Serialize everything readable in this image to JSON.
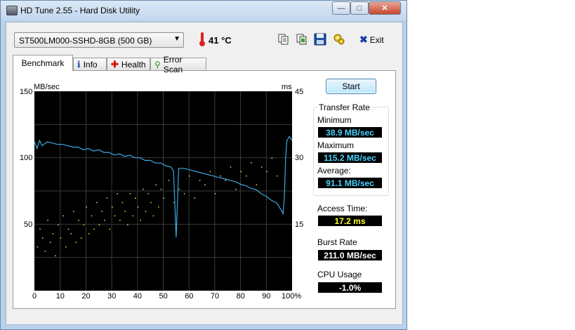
{
  "window": {
    "title": "HD Tune 2.55 - Hard Disk Utility",
    "minimize_label": "—",
    "maximize_label": "□",
    "close_label": "✕"
  },
  "toolbar": {
    "drive": "ST500LM000-SSHD-8GB (500 GB)",
    "temperature": "41 °C",
    "exit_label": "Exit",
    "icons": [
      "copy-text-icon",
      "copy-screenshot-icon",
      "save-icon",
      "options-icon",
      "exit-icon"
    ]
  },
  "tabs": [
    {
      "label": "Benchmark",
      "icon": "benchmark-icon",
      "active": true
    },
    {
      "label": "Info",
      "icon": "info-icon",
      "active": false
    },
    {
      "label": "Health",
      "icon": "health-icon",
      "active": false
    },
    {
      "label": "Error Scan",
      "icon": "magnifier-icon",
      "active": false
    }
  ],
  "benchmark": {
    "start_label": "Start",
    "transfer_rate_title": "Transfer Rate",
    "minimum_label": "Minimum",
    "minimum_value": "38.9 MB/sec",
    "maximum_label": "Maximum",
    "maximum_value": "115.2 MB/sec",
    "average_label": "Average:",
    "average_value": "91.1 MB/sec",
    "access_time_label": "Access Time:",
    "access_time_value": "17.2 ms",
    "burst_rate_label": "Burst Rate",
    "burst_rate_value": "211.0 MB/sec",
    "cpu_usage_label": "CPU Usage",
    "cpu_usage_value": "-1.0%"
  },
  "chart_data": {
    "type": "line",
    "y_left_label": "MB/sec",
    "y_right_label": "ms",
    "ylim_left": [
      0,
      150
    ],
    "ylim_right": [
      0,
      45
    ],
    "y_left_ticks": [
      "150",
      "100",
      "50"
    ],
    "y_right_ticks": [
      "45",
      "30",
      "15"
    ],
    "xlim": [
      0,
      100
    ],
    "x_ticks": [
      "0",
      "10",
      "20",
      "30",
      "40",
      "50",
      "60",
      "70",
      "80",
      "90",
      "100%"
    ],
    "grid": true,
    "colors": {
      "background": "#000000",
      "grid": "#3a3a3a",
      "transfer_line": "#3aa9e6",
      "access_points": "#e6e64a"
    },
    "series": [
      {
        "kind": "transfer_rate",
        "axis": "left",
        "x": [
          0,
          1,
          2,
          3,
          5,
          7,
          9,
          11,
          13,
          15,
          17,
          19,
          21,
          23,
          25,
          27,
          29,
          31,
          33,
          35,
          37,
          39,
          41,
          43,
          45,
          47,
          49,
          51,
          53,
          54,
          55,
          56,
          58,
          60,
          62,
          64,
          66,
          68,
          70,
          72,
          74,
          76,
          78,
          80,
          82,
          84,
          86,
          88,
          90,
          92,
          94,
          95,
          96,
          96.5,
          97,
          97.5,
          98,
          99,
          100
        ],
        "y": [
          112,
          107,
          113,
          109,
          112,
          111,
          110,
          110,
          109,
          108,
          108,
          106,
          107,
          105,
          106,
          104,
          104,
          102,
          103,
          101,
          102,
          100,
          100,
          98,
          98,
          96,
          96,
          94,
          93,
          90,
          40,
          92,
          92,
          91,
          90,
          89,
          88,
          87,
          86,
          85,
          84,
          83,
          82,
          80,
          79,
          77,
          76,
          73,
          71,
          68,
          66,
          63,
          60,
          58,
          70,
          100,
          113,
          116,
          113
        ]
      },
      {
        "kind": "access_time",
        "axis": "right",
        "x": [
          1,
          2,
          3,
          4,
          5,
          6,
          7,
          8,
          9,
          10,
          11,
          12,
          13,
          14,
          15,
          16,
          17,
          18,
          19,
          20,
          21,
          22,
          23,
          24,
          25,
          26,
          27,
          28,
          29,
          30,
          31,
          32,
          33,
          34,
          35,
          36,
          37,
          38,
          39,
          40,
          41,
          42,
          43,
          44,
          45,
          46,
          47,
          48,
          49,
          50,
          52,
          54,
          56,
          58,
          60,
          62,
          64,
          66,
          68,
          70,
          72,
          74,
          76,
          78,
          80,
          82,
          84,
          86,
          88,
          90,
          92,
          94
        ],
        "y": [
          10,
          14,
          12,
          9,
          16,
          11,
          13,
          8,
          15,
          12,
          17,
          10,
          14,
          13,
          18,
          11,
          16,
          12,
          15,
          19,
          13,
          17,
          14,
          20,
          15,
          18,
          16,
          21,
          14,
          19,
          17,
          22,
          16,
          20,
          18,
          15,
          22,
          17,
          21,
          19,
          16,
          23,
          18,
          22,
          20,
          17,
          24,
          19,
          23,
          21,
          25,
          20,
          23,
          22,
          26,
          21,
          25,
          24,
          27,
          22,
          26,
          25,
          28,
          23,
          27,
          26,
          29,
          24,
          28,
          27,
          30,
          26
        ]
      }
    ]
  }
}
